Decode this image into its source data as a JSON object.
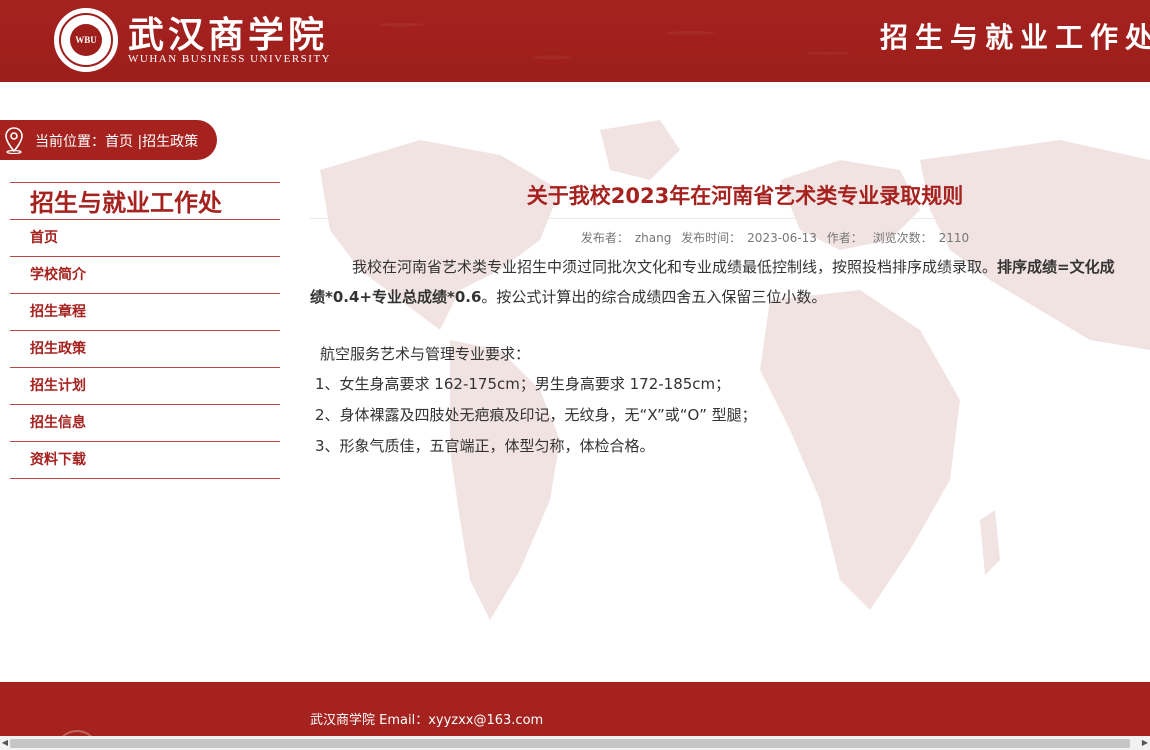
{
  "header": {
    "logo_cn": "武汉商学院",
    "logo_en": "WUHAN BUSINESS UNIVERSITY",
    "seal_text": "WBU",
    "title": "招生与就业工作处"
  },
  "breadcrumb": {
    "prefix": "当前位置：",
    "home": "首页",
    "separator": " |",
    "current": "招生政策"
  },
  "sidebar": {
    "title": "招生与就业工作处",
    "items": [
      {
        "label": "首页"
      },
      {
        "label": "学校简介"
      },
      {
        "label": "招生章程"
      },
      {
        "label": "招生政策"
      },
      {
        "label": "招生计划"
      },
      {
        "label": "招生信息"
      },
      {
        "label": "资料下载"
      }
    ]
  },
  "article": {
    "title": "关于我校2023年在河南省艺术类专业录取规则",
    "meta": {
      "publisher_label": "发布者：",
      "publisher": "zhang",
      "date_label": "发布时间：",
      "date": "2023-06-13",
      "author_label": "作者：",
      "views_label": "浏览次数：",
      "views": "2110"
    },
    "para1_a": "我校在河南省艺术类专业招生中须过同批次文化和专业成绩最低控制线，按照投档排序成绩录取。",
    "para1_bold_a": "排序成绩=文化成",
    "para1_bold_b": "绩*0.4+专业总成绩*0.6",
    "para1_b": "。按公式计算出的综合成绩四舍五入保留三位小数。",
    "req_heading": "航空服务艺术与管理专业要求：",
    "requirements": [
      "1、女生身高要求 162-175cm；男生身高要求 172-185cm；",
      "2、身体裸露及四肢处无疤痕及印记，无纹身，无“X”或“O” 型腿；",
      "3、形象气质佳，五官端正，体型匀称，体检合格。"
    ]
  },
  "footer": {
    "text": "武汉商学院 Email：xyyzxx@163.com"
  },
  "colors": {
    "brand_red": "#a5221f",
    "map_tint": "#f2e3e3"
  }
}
